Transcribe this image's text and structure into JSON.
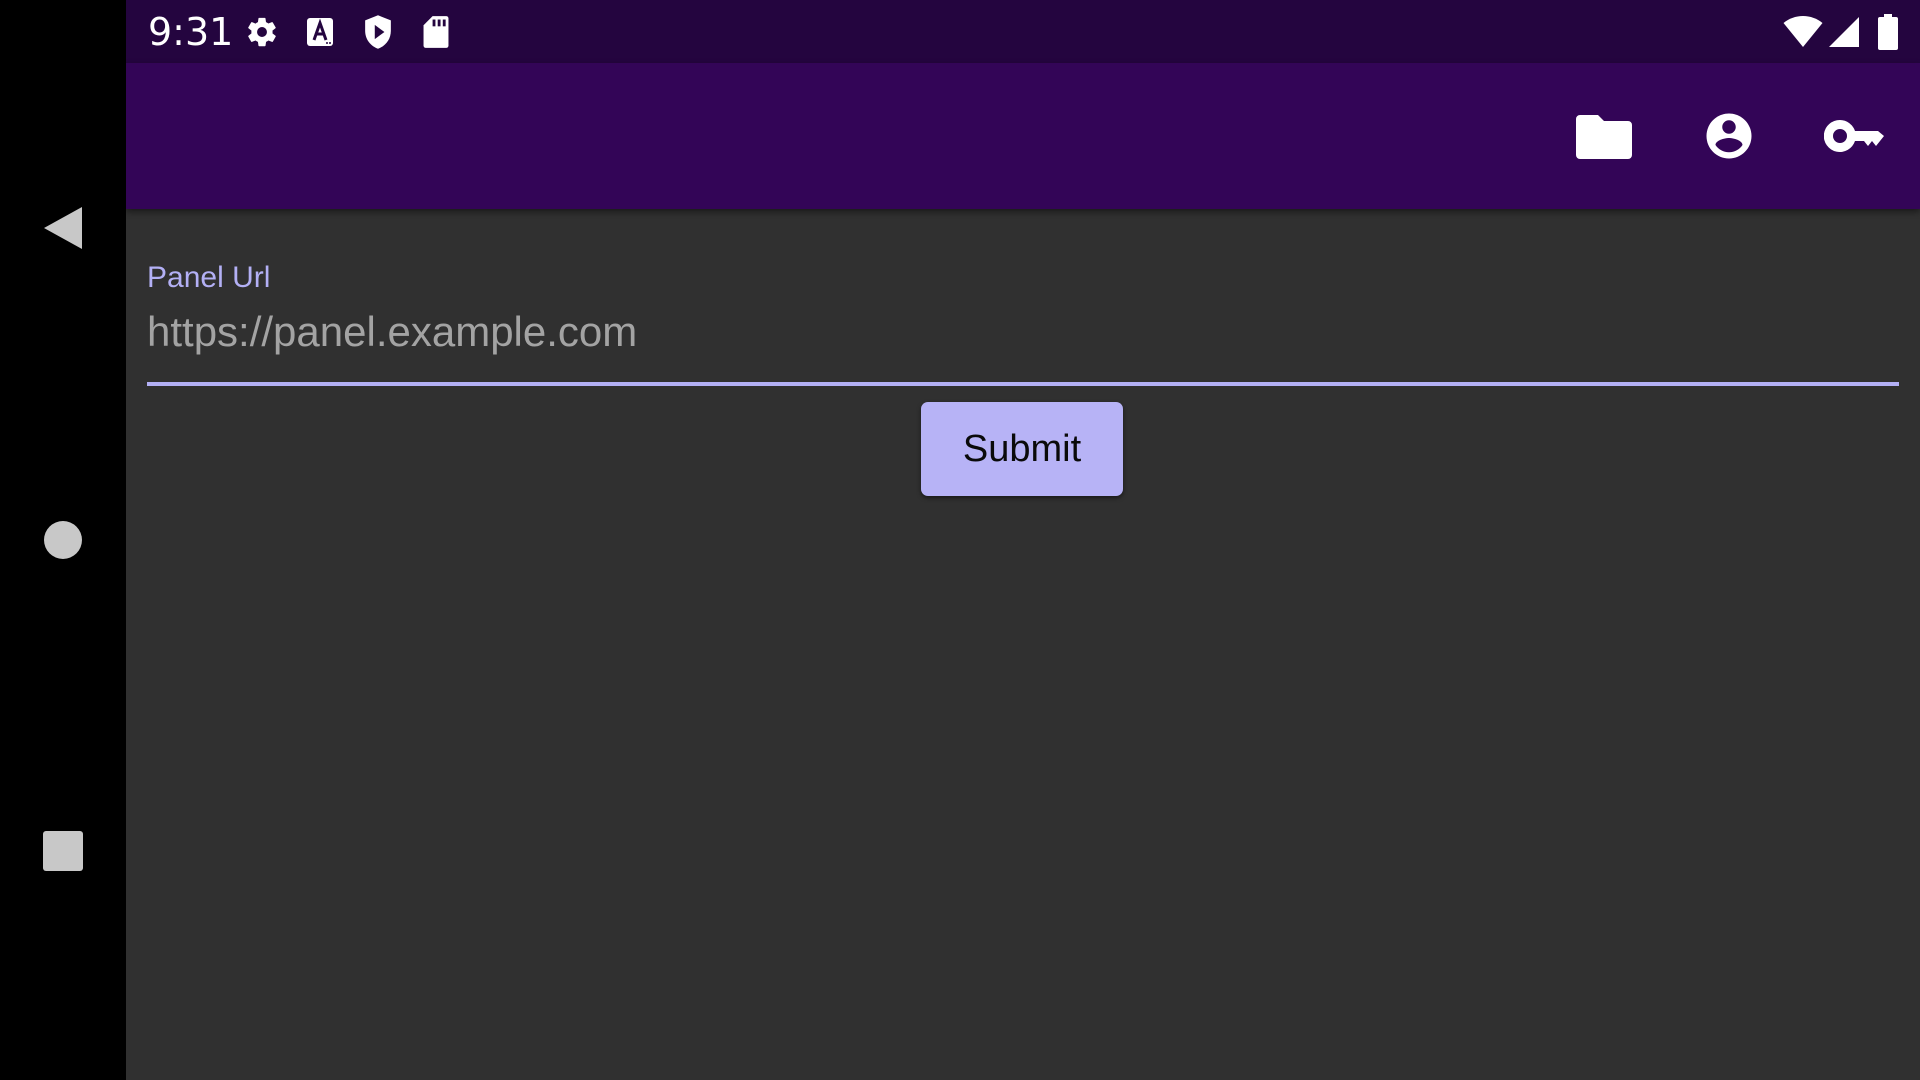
{
  "status_bar": {
    "time": "9:31",
    "left_icons": [
      "gear-icon",
      "font-a-icon",
      "shield-play-icon",
      "sd-card-icon"
    ],
    "right_icons": [
      "wifi-icon",
      "cell-signal-icon",
      "battery-icon"
    ]
  },
  "navigation_bar": {
    "buttons": [
      "back-icon",
      "home-icon",
      "recents-icon"
    ]
  },
  "app_bar": {
    "title": "",
    "actions": [
      "folder-icon",
      "account-circle-icon",
      "key-icon"
    ],
    "color": "#330557"
  },
  "form": {
    "panel_url": {
      "label": "Panel Url",
      "value": "",
      "placeholder": "https://panel.example.com"
    },
    "submit_label": "Submit"
  },
  "colors": {
    "accent": "#b3b0f5",
    "background": "#303030",
    "status_bar": "#24053f",
    "button": "#b7b3f6"
  }
}
